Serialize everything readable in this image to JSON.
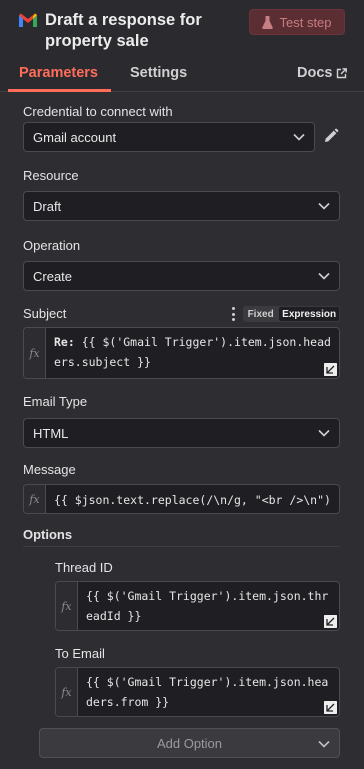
{
  "header": {
    "title": "Draft a response for property sale",
    "test_button": "Test step",
    "colors": {
      "accent": "#ff6d5a",
      "test_bg": "#5a2e33"
    }
  },
  "tabs": {
    "parameters": "Parameters",
    "settings": "Settings",
    "docs": "Docs"
  },
  "credential": {
    "label": "Credential to connect with",
    "value": "Gmail account"
  },
  "resource": {
    "label": "Resource",
    "value": "Draft"
  },
  "operation": {
    "label": "Operation",
    "value": "Create"
  },
  "subject": {
    "label": "Subject",
    "toggle_fixed": "Fixed",
    "toggle_expression": "Expression",
    "value_prefix": "Re: ",
    "value": "{{ $('Gmail Trigger').item.json.headers.subject }}"
  },
  "email_type": {
    "label": "Email Type",
    "value": "HTML"
  },
  "message": {
    "label": "Message",
    "value": "{{ $json.text.replace(/\\n/g, \"<br />\\n\") }}"
  },
  "options": {
    "label": "Options",
    "thread_id": {
      "label": "Thread ID",
      "value": "{{ $('Gmail Trigger').item.json.threadId }}"
    },
    "to_email": {
      "label": "To Email",
      "value": "{{ $('Gmail Trigger').item.json.headers.from }}"
    },
    "add_option": "Add Option"
  },
  "icons": {
    "fx": "fx",
    "external": "external-link-icon",
    "chevron": "chevron-down-icon",
    "pencil": "pencil-icon",
    "flask": "flask-icon",
    "resize": "resize-handle-icon"
  }
}
